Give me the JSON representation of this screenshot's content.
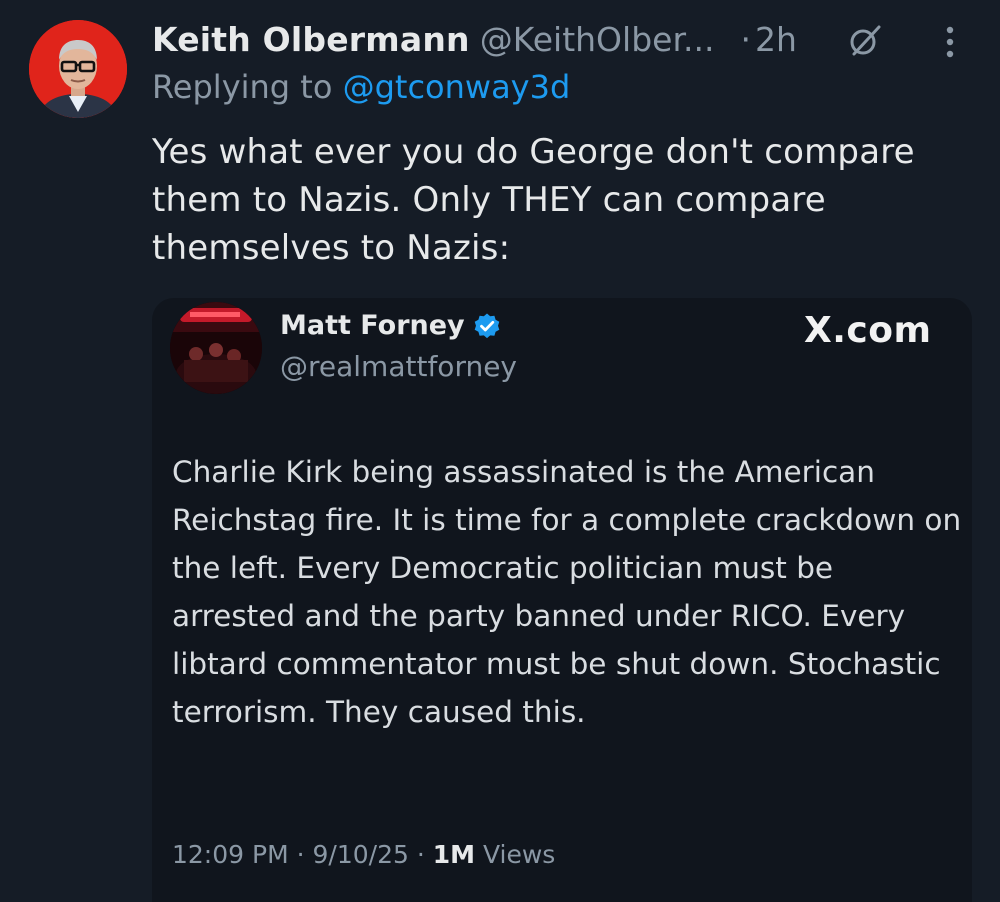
{
  "post": {
    "author_name": "Keith Olbermann",
    "author_handle": "@KeithOlber...",
    "separator": "·",
    "time": "2h",
    "replying_prefix": "Replying to ",
    "replying_to": "@gtconway3d",
    "text": "Yes what ever you do George don't compare them to Nazis. Only THEY can compare themselves to Nazis:",
    "icons": {
      "grok": "grok-icon",
      "more": "more-vertical-icon"
    },
    "colors": {
      "background": "#151c26",
      "link": "#1d9bf0",
      "muted": "#8b98a5",
      "avatar_bg": "#e0241b"
    }
  },
  "quote": {
    "author_name": "Matt Forney",
    "author_handle": "@realmattforney",
    "source": "X.com",
    "text": "Charlie Kirk being assassinated is the American Reichstag fire. It is time for a complete crackdown on the left. Every Democratic politician must be arrested and the party banned under RICO. Every libtard commentator must be shut down. Stochastic terrorism. They caused this.",
    "time": "12:09 PM",
    "date": "9/10/25",
    "separator": "·",
    "views_count": "1M",
    "views_label": "Views",
    "icons": {
      "verified": "verified-badge-icon"
    },
    "colors": {
      "verified": "#1d9bf0"
    }
  }
}
